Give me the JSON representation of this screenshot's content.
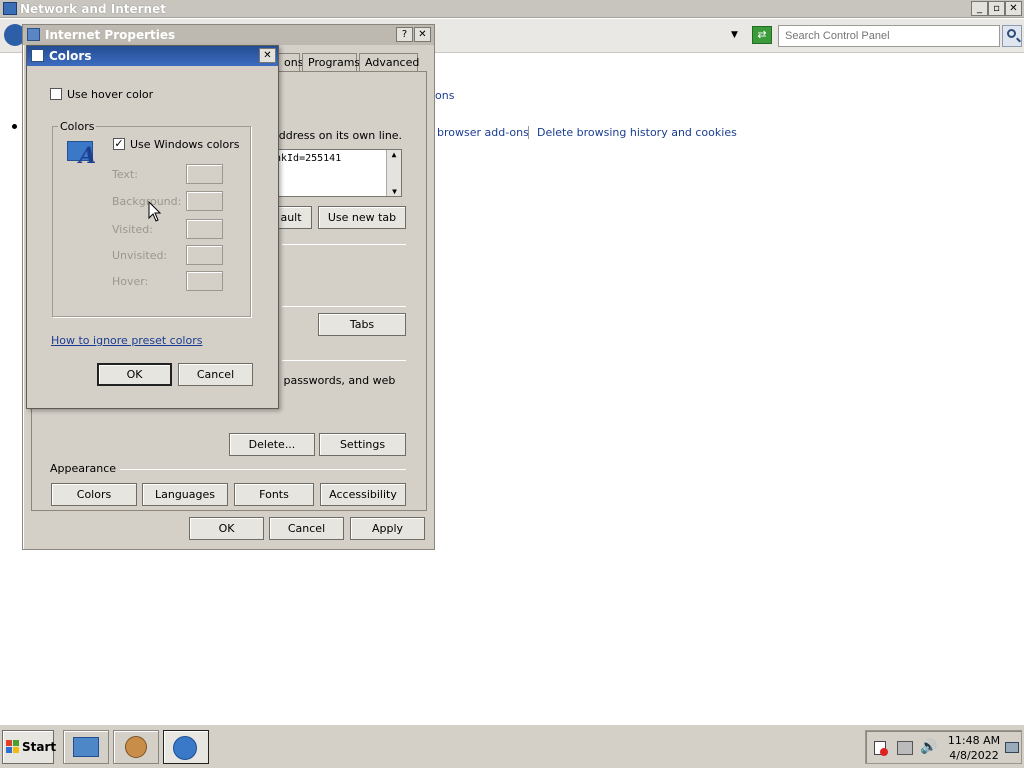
{
  "cp_window": {
    "title": "Network and Internet",
    "search_placeholder": "Search Control Panel",
    "link_options": "ons",
    "link_addons": "browser add-ons",
    "link_history": "Delete browsing history and cookies"
  },
  "ip_dialog": {
    "title": "Internet Properties",
    "help": "?",
    "close": "✕",
    "tabs": [
      "ons",
      "Programs",
      "Advanced"
    ],
    "home_text": "address on its own line.",
    "home_url": "nkId=255141",
    "use_default": "ault",
    "use_new_tab": "Use new tab",
    "tabs_button": "Tabs",
    "history_text_1": "d passwords, and web",
    "delete_button": "Delete...",
    "settings_button": "Settings",
    "appearance_label": "Appearance",
    "colors_button": "Colors",
    "languages_button": "Languages",
    "fonts_button": "Fonts",
    "accessibility_button": "Accessibility",
    "ok": "OK",
    "cancel": "Cancel",
    "apply": "Apply"
  },
  "colors_dialog": {
    "title": "Colors",
    "close": "✕",
    "hover_label": "Use hover color",
    "hover_checked": false,
    "group_label": "Colors",
    "windows_label": "Use Windows colors",
    "windows_checked": true,
    "check_mark": "✓",
    "text_label": "Text:",
    "background_label": "Background:",
    "visited_label": "Visited:",
    "unvisited_label": "Unvisited:",
    "hover_color_label": "Hover:",
    "help_link": "How to ignore preset colors",
    "ok": "OK",
    "cancel": "Cancel"
  },
  "taskbar": {
    "start": "Start",
    "time": "11:48 AM",
    "date": "4/8/2022"
  },
  "colors": {
    "accent": "#234d93",
    "link": "#1b3d91"
  }
}
